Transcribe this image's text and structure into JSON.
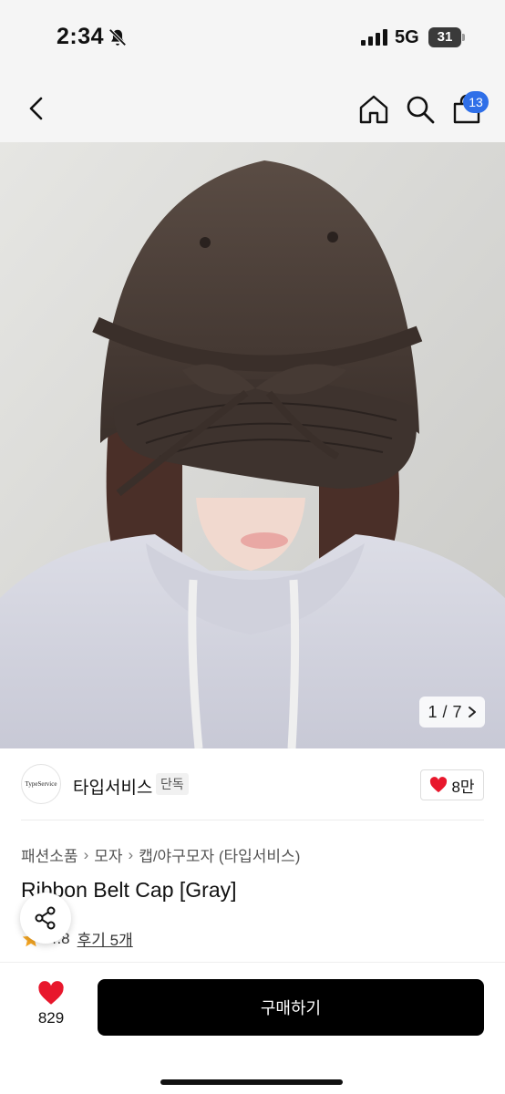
{
  "status_bar": {
    "time": "2:34",
    "network": "5G",
    "battery": "31"
  },
  "nav": {
    "cart_count": "13"
  },
  "gallery": {
    "current": "1",
    "separator": "/",
    "total": "7"
  },
  "seller": {
    "logo_text": "TypeService",
    "name": "타입서비스",
    "badge": "단독",
    "likes": "8만"
  },
  "product": {
    "breadcrumb": [
      "패션소품",
      "모자",
      "캡/야구모자 (타입서비스)"
    ],
    "title": "Ribbon Belt Cap [Gray]",
    "rating": "4.8",
    "review_link": "후기 5개"
  },
  "bottom_bar": {
    "wish_count": "829",
    "buy_label": "구매하기"
  },
  "colors": {
    "accent_blue": "#2f6fe8",
    "heart_red": "#e8172c",
    "star_orange": "#f5a623",
    "buy_button": "#000000"
  }
}
